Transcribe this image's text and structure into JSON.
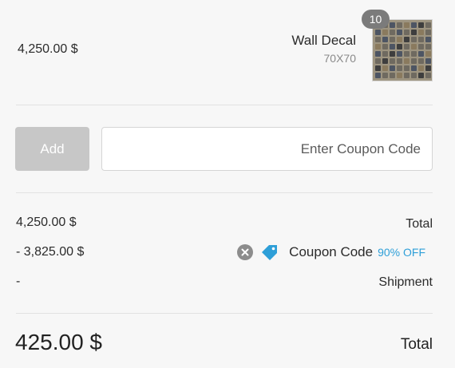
{
  "product": {
    "price": "4,250.00 $",
    "name": "Wall Decal",
    "size": "70X70",
    "quantity": "10",
    "thumbnail_icon": "wall-decal-thumbnail"
  },
  "coupon": {
    "add_label": "Add",
    "placeholder": "Enter Coupon Code",
    "value": ""
  },
  "summary": {
    "subtotal_value": "4,250.00 $",
    "subtotal_label": "Total",
    "discount_value": "- 3,825.00 $",
    "coupon_label": "Coupon Code",
    "coupon_discount": "90% OFF",
    "shipment_value": "-",
    "shipment_label": "Shipment",
    "grand_total_value": "425.00 $",
    "grand_total_label": "Total"
  },
  "icons": {
    "remove": "close-circle-icon",
    "tag": "price-tag-icon"
  },
  "colors": {
    "accent": "#2e9fd8",
    "add_button_bg": "#c7c7c7",
    "badge_bg": "#7b7b7b"
  }
}
